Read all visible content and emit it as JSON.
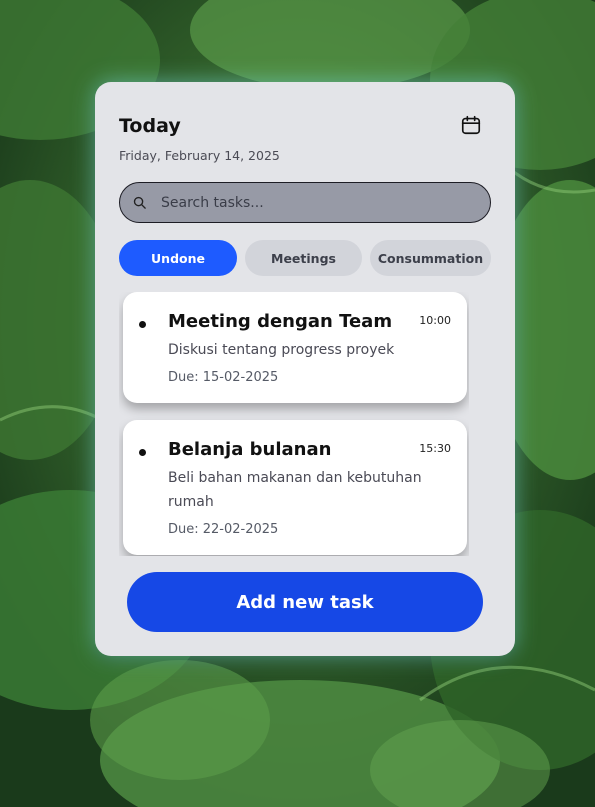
{
  "header": {
    "title": "Today",
    "date": "Friday, February 14, 2025"
  },
  "search": {
    "placeholder": "Search tasks...",
    "value": ""
  },
  "tabs": [
    {
      "label": "Undone",
      "active": true
    },
    {
      "label": "Meetings",
      "active": false
    },
    {
      "label": "Consummation",
      "active": false
    }
  ],
  "tasks": [
    {
      "title": "Meeting dengan Team",
      "time": "10:00",
      "description": "Diskusi tentang progress proyek",
      "due": "Due: 15-02-2025"
    },
    {
      "title": "Belanja bulanan",
      "time": "15:30",
      "description": "Beli bahan makanan dan kebutuhan rumah",
      "due": "Due: 22-02-2025"
    }
  ],
  "add_button_label": "Add new task",
  "icons": {
    "calendar": "calendar-icon",
    "search": "search-icon"
  },
  "colors": {
    "accent": "#1e5bff",
    "add_button": "#1648e6",
    "card_background": "#e3e4e8"
  }
}
